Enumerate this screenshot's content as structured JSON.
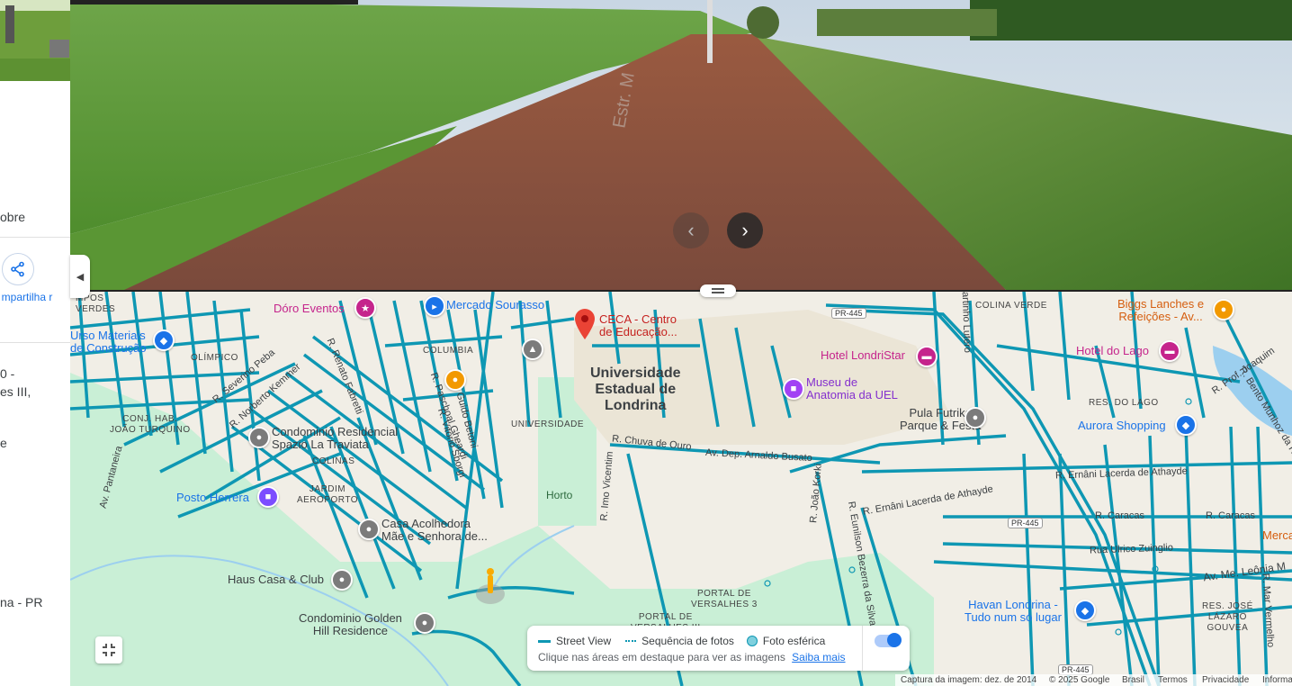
{
  "left_panel": {
    "fragment_sobre": "obre",
    "share_label": "mpartilha r",
    "address_line1": "0 -",
    "address_line2": "es III,",
    "address_line3": "e",
    "city_fragment": "na - PR",
    "share_icon": "share-icon"
  },
  "street_view": {
    "prev_icon": "chevron-left-icon",
    "next_icon": "chevron-right-icon",
    "road_marking": "Estr. M"
  },
  "collapse_icon": "triangle-left-icon",
  "map": {
    "neighborhoods": {
      "campos_verdes": "MPOS\nVERDES",
      "olimpico": "OLÍMPICO",
      "conj_hab": "CONJ. HAB.\nJOÃO TURQUINO",
      "colinas": "COLINAS",
      "jardim_aeroporto": "JARDIM\nAEROPORTO",
      "columbia": "COLUMBIA",
      "universidade": "UNIVERSIDADE",
      "colina_verde": "COLINA VERDE",
      "res_do_lago": "RES. DO LAGO",
      "portal_versalhes_3": "PORTAL DE\nVERSALHES 3",
      "portal_versalhes_iii": "PORTAL DE\nVERSALHES III",
      "res_jose_lazaro": "RES. JOSÉ\nLÁZARO\nGOUVEA"
    },
    "roads": {
      "severino_peba": "R. Severino Peba",
      "norberto_kemmer": "R. Norberto Kemmer",
      "renato_fabretti": "R. Renato Fabretti",
      "paschoal_gheardi": "R. Paschoal Gheardi",
      "guido_betoni": "R. Guido Betoni",
      "vitorio_sborgi": "R. Vitório Sborgi",
      "av_pantaneira": "Av. Pantaneira",
      "chuva_de_ouro": "R. Chuva de Ouro",
      "arnaldo_busato": "Av. Dep. Arnaldo Busato",
      "imo_vicentim": "R. Imo Vicentim",
      "joao_korki": "R. João Korki",
      "ernani_lacerda_1": "R. Ernâni Lacerda de Athayde",
      "ernani_lacerda_2": "R. Ernâni Lacerda de Athayde",
      "eunilson_bezerra": "R. Eunilson Bezerra da Silva",
      "caracas_1": "R. Caracas",
      "caracas_2": "R. Caracas",
      "ulrico_zuinglio": "Rua Ulrico Zuinglio",
      "leonia": "Av. Me. Leônia M",
      "mar_vermelho": "R. Mar Vermelho",
      "prof_joaquim": "R. Prof. Joaquim",
      "bento_munhoz": "R. Bento Munhoz da Rocha",
      "lutero": "artinho Lutero",
      "pr445_a": "PR-445",
      "pr445_b": "PR-445",
      "pr445_c": "PR-445"
    },
    "pois": {
      "doro_eventos": "Dóro Eventos",
      "mercado_sourasso": "Mercado Sourasso",
      "ceca": "CECA - Centro\nde Educação...",
      "urso_materiais": "Urso Materiais\nde Construção",
      "universidade": "Universidade\nEstadual de\nLondrina",
      "museu": "Museu de\nAnatomia da UEL",
      "hotel_londristar": "Hotel LondriStar",
      "hotel_do_lago": "Hotel do Lago",
      "biggs": "Biggs Lanches e\nRefeições - Av...",
      "pula_futrika": "Pula Futrika\nParque & Festa",
      "aurora_shopping": "Aurora Shopping",
      "spazio": "Condominio Residencial\nSpazio La Traviata",
      "posto_herrera": "Posto Herrera",
      "casa_acolhedora": "Casa Acolhedora\nMãe e Senhora de...",
      "haus_casa": "Haus Casa & Club",
      "golden_hill": "Condominio Golden\nHill Residence",
      "horto": "Horto",
      "havan": "Havan Londrina -\nTudo num só lugar",
      "merca": "Merca"
    }
  },
  "legend": {
    "street_view": "Street View",
    "photo_sequence": "Sequência de fotos",
    "spherical_photo": "Foto esférica",
    "hint": "Clique nas áreas em destaque para ver as imagens",
    "learn_more": "Saiba mais",
    "toggle_on": true
  },
  "footer": {
    "capture": "Captura da imagem: dez. de 2014",
    "copyright": "© 2025 Google",
    "country": "Brasil",
    "terms": "Termos",
    "privacy": "Privacidade",
    "info": "Informa"
  },
  "colors": {
    "coverage": "#0e97b3",
    "park": "#c9efd6",
    "water": "#9ccfef",
    "campus": "#ece6d8",
    "pin_red": "#ea4335"
  }
}
